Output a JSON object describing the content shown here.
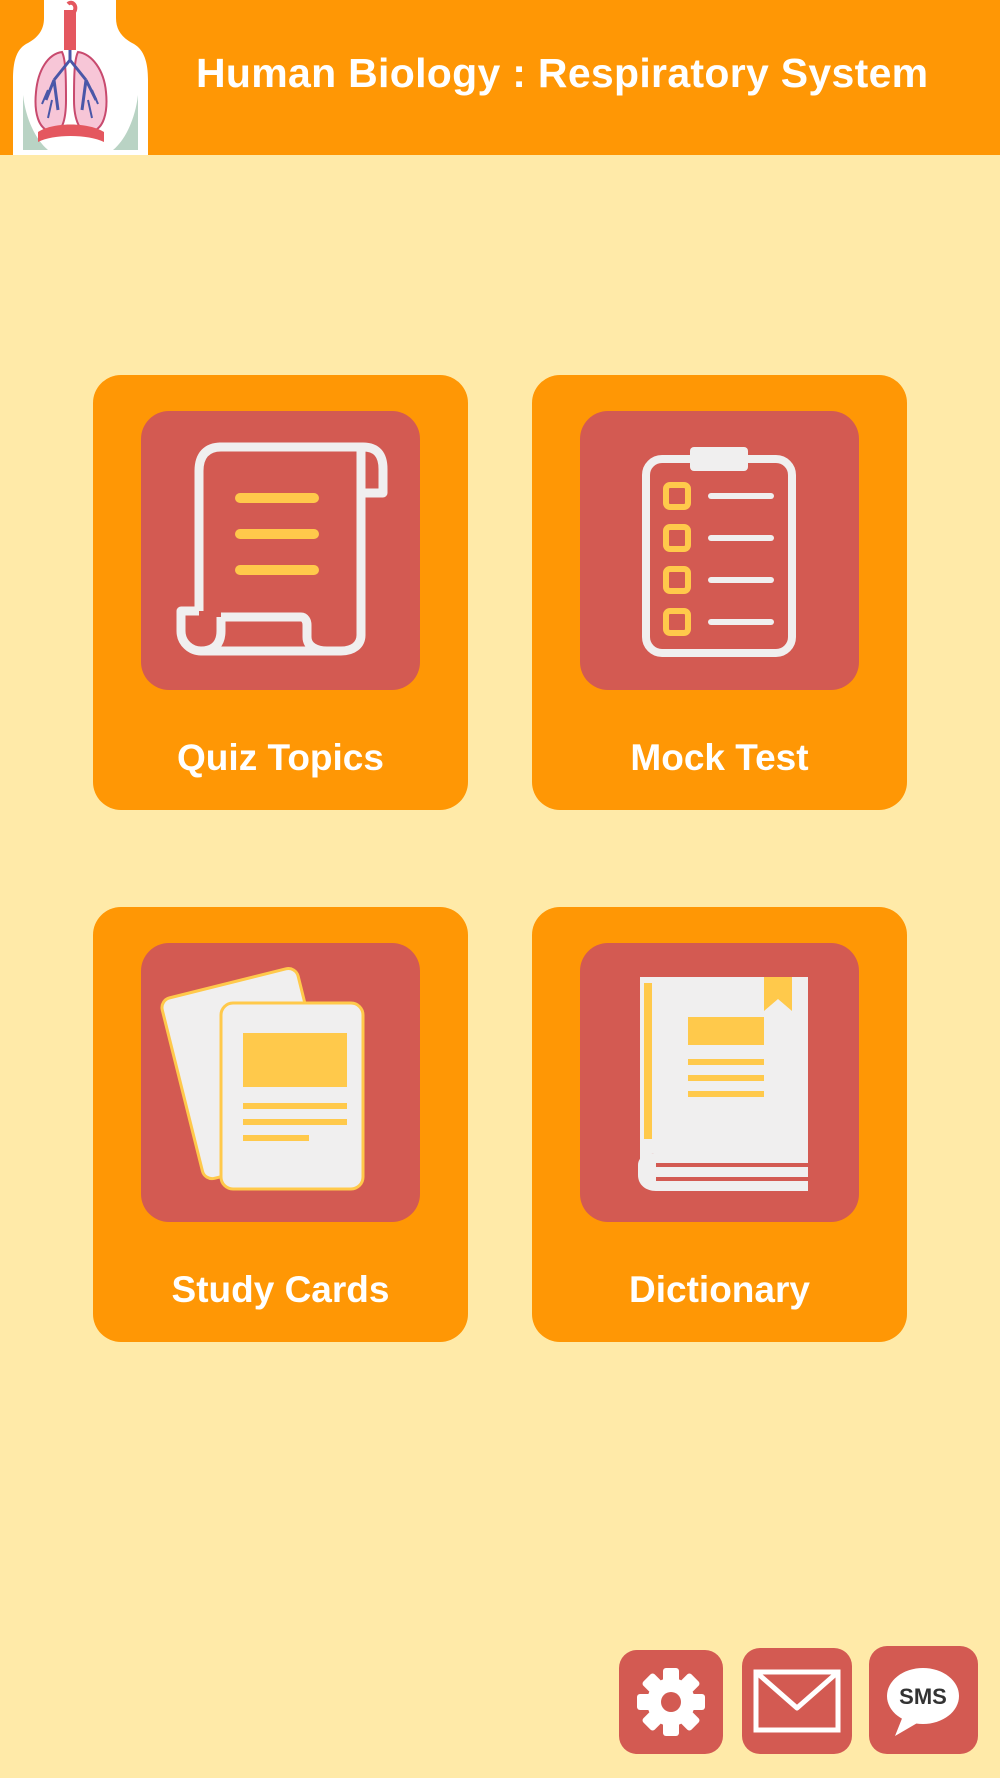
{
  "header": {
    "title": "Human Biology : Respiratory System",
    "logo_icon": "respiratory-system-logo"
  },
  "menu": {
    "tiles": [
      {
        "label": "Quiz Topics",
        "icon": "scroll-icon"
      },
      {
        "label": "Mock Test",
        "icon": "clipboard-checklist-icon"
      },
      {
        "label": "Study Cards",
        "icon": "flash-cards-icon"
      },
      {
        "label": "Dictionary",
        "icon": "book-icon"
      }
    ]
  },
  "bottom_bar": {
    "settings_icon": "gear-icon",
    "mail_icon": "mail-icon",
    "sms_label": "SMS"
  },
  "colors": {
    "background": "#FFEAA8",
    "header": "#FF9705",
    "tile": "#FF9705",
    "icon_tile": "#D35A52",
    "icon_stroke": "#F0EFEF",
    "icon_accent": "#FFC94B"
  }
}
